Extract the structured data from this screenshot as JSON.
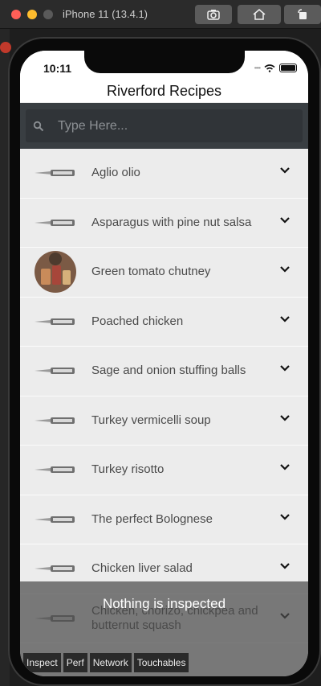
{
  "simulator": {
    "title": "iPhone 11 (13.4.1)",
    "buttons": [
      "screenshot-icon",
      "home-icon",
      "rotate-icon"
    ]
  },
  "status": {
    "time": "10:11",
    "signal": "••••"
  },
  "app": {
    "title": "Riverford Recipes",
    "search_placeholder": "Type Here..."
  },
  "recipes": [
    {
      "label": "Aglio olio",
      "thumb": "riverford-knife-logo"
    },
    {
      "label": "Asparagus with pine nut salsa",
      "thumb": "riverford-knife-logo"
    },
    {
      "label": "Green tomato chutney",
      "thumb": "chutney-jars-photo"
    },
    {
      "label": "Poached chicken",
      "thumb": "riverford-knife-logo"
    },
    {
      "label": "Sage and onion stuffing balls",
      "thumb": "riverford-knife-logo"
    },
    {
      "label": "Turkey vermicelli soup",
      "thumb": "riverford-knife-logo"
    },
    {
      "label": "Turkey risotto",
      "thumb": "riverford-knife-logo"
    },
    {
      "label": "The perfect Bolognese",
      "thumb": "riverford-knife-logo"
    },
    {
      "label": "Chicken liver salad",
      "thumb": "riverford-knife-logo"
    },
    {
      "label": "Chicken, chorizo, chickpea and butternut squash",
      "thumb": "riverford-knife-logo"
    }
  ],
  "inspector": {
    "message": "Nothing is inspected",
    "tabs": [
      "Inspect",
      "Perf",
      "Network",
      "Touchables"
    ]
  },
  "colors": {
    "search_bar": "#393e42",
    "list_bg": "#ececec",
    "overlay": "#4b4b4b"
  }
}
